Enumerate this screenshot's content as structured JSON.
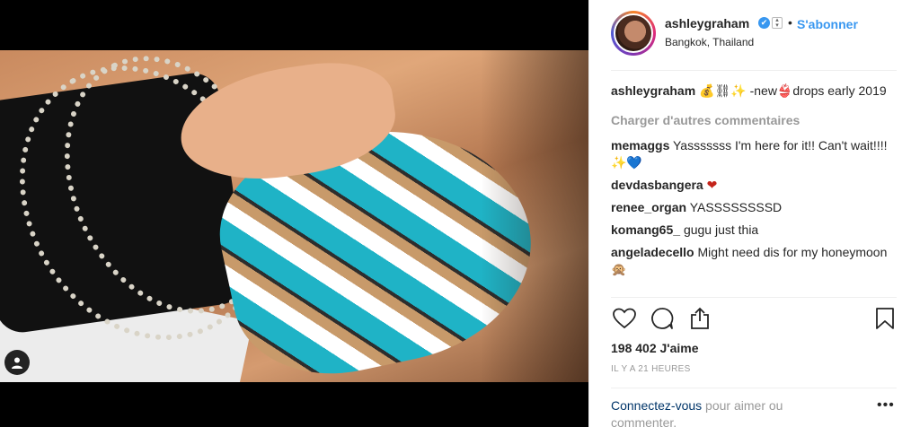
{
  "header": {
    "username": "ashleygraham",
    "verified_glyph": "✔",
    "separator": "•",
    "follow_label": "S'abonner",
    "location": "Bangkok, Thailand"
  },
  "caption": {
    "username": "ashleygraham",
    "text": "💰⛓✨ -new👙drops early 2019"
  },
  "load_more_label": "Charger d'autres commentaires",
  "comments": [
    {
      "username": "memaggs",
      "text": "Yasssssss I'm here for it!! Can't wait!!!! ✨💙"
    },
    {
      "username": "devdasbangera",
      "text": "❤"
    },
    {
      "username": "renee_organ",
      "text": "YASSSSSSSSD"
    },
    {
      "username": "komang65_",
      "text": "gugu just thia"
    },
    {
      "username": "angeladecello",
      "text": "Might need dis for my honeymoon 🙊"
    }
  ],
  "icons": {
    "like": "heart-icon",
    "comment": "comment-icon",
    "share": "share-icon",
    "save": "bookmark-icon",
    "tag": "user-tag-icon"
  },
  "likes_text": "198 402 J'aime",
  "timestamp": "IL Y A 21 HEURES",
  "login_prompt": {
    "link_text": "Connectez-vous",
    "rest_text": " pour aimer ou commenter."
  },
  "more_options": "•••",
  "colors": {
    "link_blue": "#3897f0",
    "text": "#262626",
    "muted": "#999999",
    "dark_link": "#003569",
    "heart_red": "#c4241b"
  }
}
